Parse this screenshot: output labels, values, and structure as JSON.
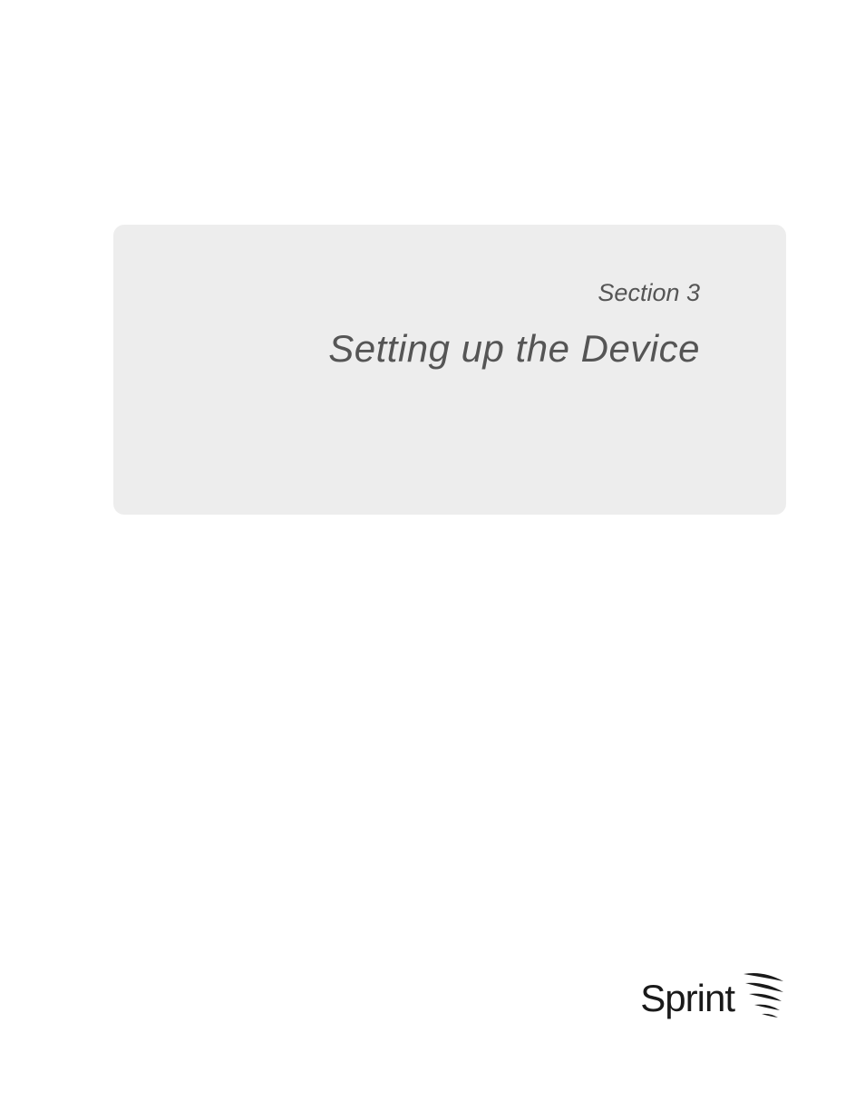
{
  "section": {
    "label": "Section 3",
    "title": "Setting up the Device"
  },
  "brand": {
    "name": "Sprint"
  }
}
